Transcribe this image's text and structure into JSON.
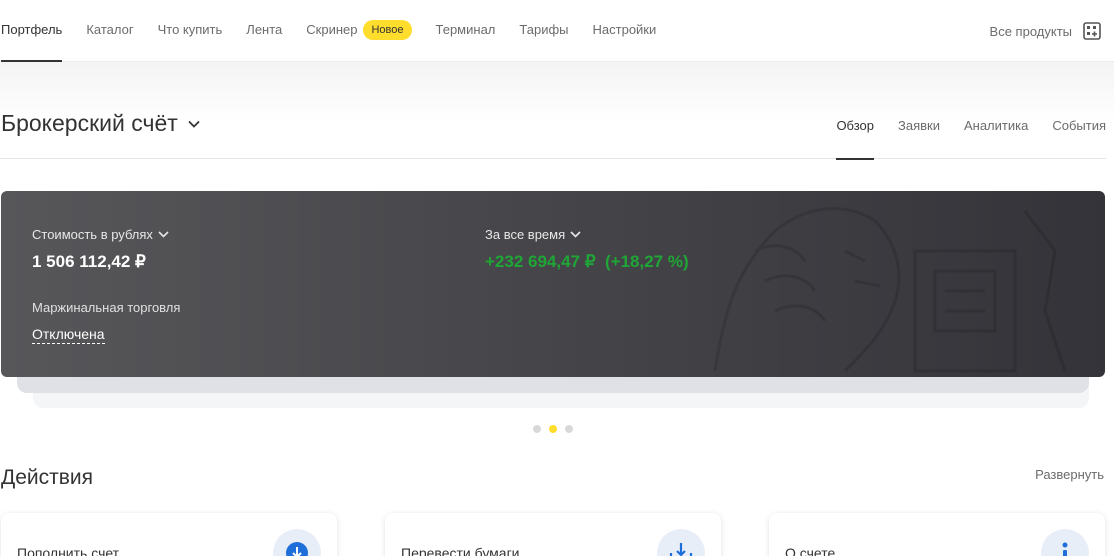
{
  "nav": {
    "items": [
      {
        "label": "Портфель",
        "active": true
      },
      {
        "label": "Каталог"
      },
      {
        "label": "Что купить"
      },
      {
        "label": "Лента"
      },
      {
        "label": "Скринер",
        "badge": "Новое"
      },
      {
        "label": "Терминал"
      },
      {
        "label": "Тарифы"
      },
      {
        "label": "Настройки"
      }
    ],
    "all_products": "Все продукты",
    "all_products_icon": "apps-plus-icon"
  },
  "account": {
    "title": "Брокерский счёт",
    "tabs": [
      "Обзор",
      "Заявки",
      "Аналитика",
      "События"
    ],
    "active_tab": "Обзор"
  },
  "summary": {
    "value_label": "Стоимость в рублях",
    "value": "1 506 112,42 ₽",
    "period_label": "За все время",
    "gain": "+232 694,47 ₽  (+18,27 %)",
    "margin_label": "Маржинальная торговля",
    "margin_status": "Отключена",
    "gain_color": "#1fa636"
  },
  "carousel": {
    "count": 3,
    "active_index": 1,
    "active_color": "#ffdd2d"
  },
  "actions": {
    "title": "Действия",
    "expand": "Развернуть",
    "cards": [
      {
        "label": "Пополнить счет",
        "icon": "download-arrow-icon"
      },
      {
        "label": "Перевести бумаги",
        "icon": "transfer-papers-icon"
      },
      {
        "label": "О счете",
        "icon": "info-icon"
      }
    ]
  }
}
